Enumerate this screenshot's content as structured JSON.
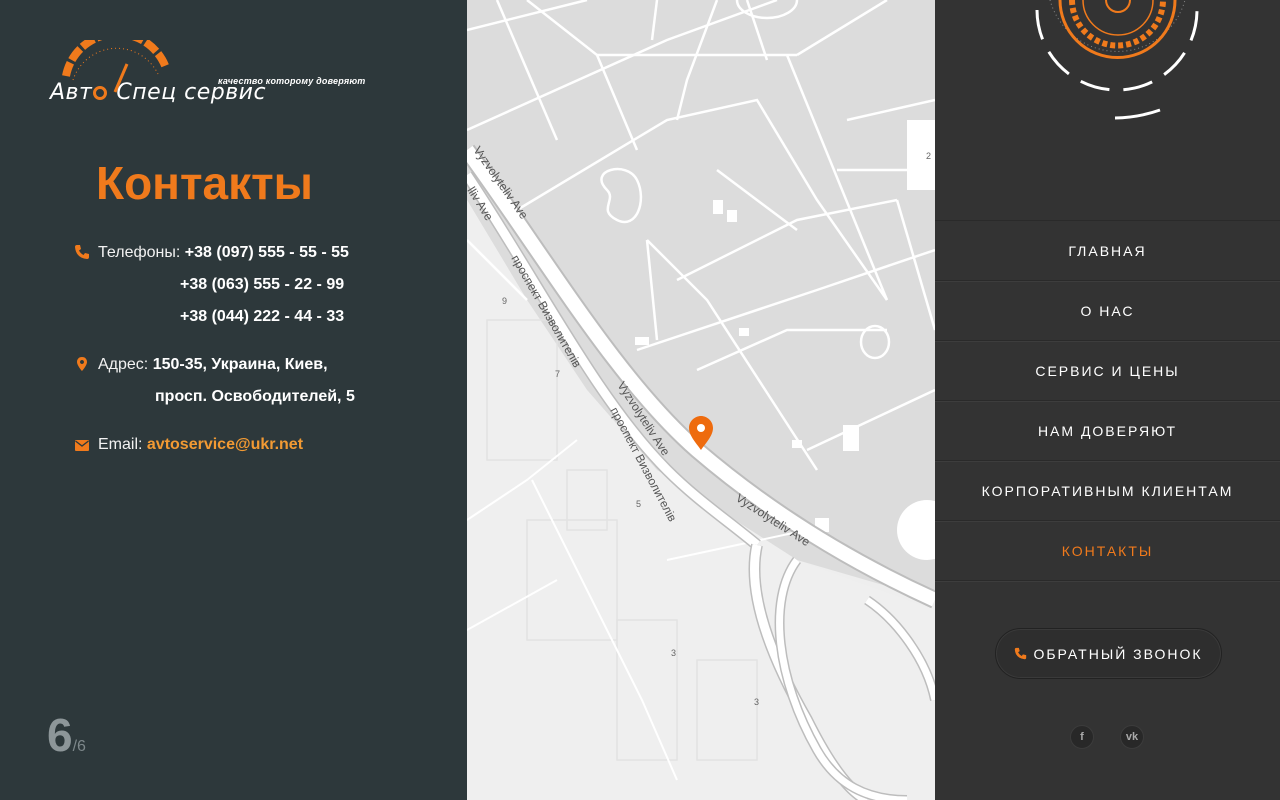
{
  "logo": {
    "tagline": "качество которому доверяют",
    "brand_part1": "Авт",
    "brand_part2": "Спец сервис"
  },
  "contacts": {
    "title": "Контакты",
    "phones_label": "Телефоны:",
    "phones": [
      "+38 (097) 555 - 55 - 55",
      "+38 (063) 555 - 22 - 99",
      "+38 (044) 222 - 44 - 33"
    ],
    "address_label": "Адрес:",
    "address_line1": "150-35, Украина, Киев,",
    "address_line2": "просп. Освободителей, 5",
    "email_label": "Email:",
    "email": "avtoservice@ukr.net"
  },
  "pager": {
    "current": "6",
    "total": "/6"
  },
  "map": {
    "street_labels": [
      "Vyzvolyteliv Ave",
      "Vyzvolyteliv Ave",
      "проспект Визволителів",
      "Vyzvolyteliv Ave",
      "проспект Визволителів",
      "Vyzvolyteliv Ave",
      "lliv Ave"
    ],
    "house_numbers": [
      "9",
      "7",
      "5",
      "3",
      "3",
      "2"
    ],
    "pin_icon": "map-pin-icon",
    "pin_color": "#ee6b0e"
  },
  "nav": {
    "items": [
      "ГЛАВНАЯ",
      "О НАС",
      "СЕРВИС И ЦЕНЫ",
      "НАМ ДОВЕРЯЮТ",
      "КОРПОРАТИВНЫМ КЛИЕНТАМ",
      "КОНТАКТЫ"
    ],
    "active_index": 5
  },
  "callback_label": "ОБРАТНЫЙ ЗВОНОК",
  "social": {
    "facebook": "f",
    "vk": "vk"
  },
  "colors": {
    "accent": "#f07a1c",
    "left_bg": "#2d383b",
    "right_bg": "#333333",
    "map_bg": "#eeeeee"
  }
}
